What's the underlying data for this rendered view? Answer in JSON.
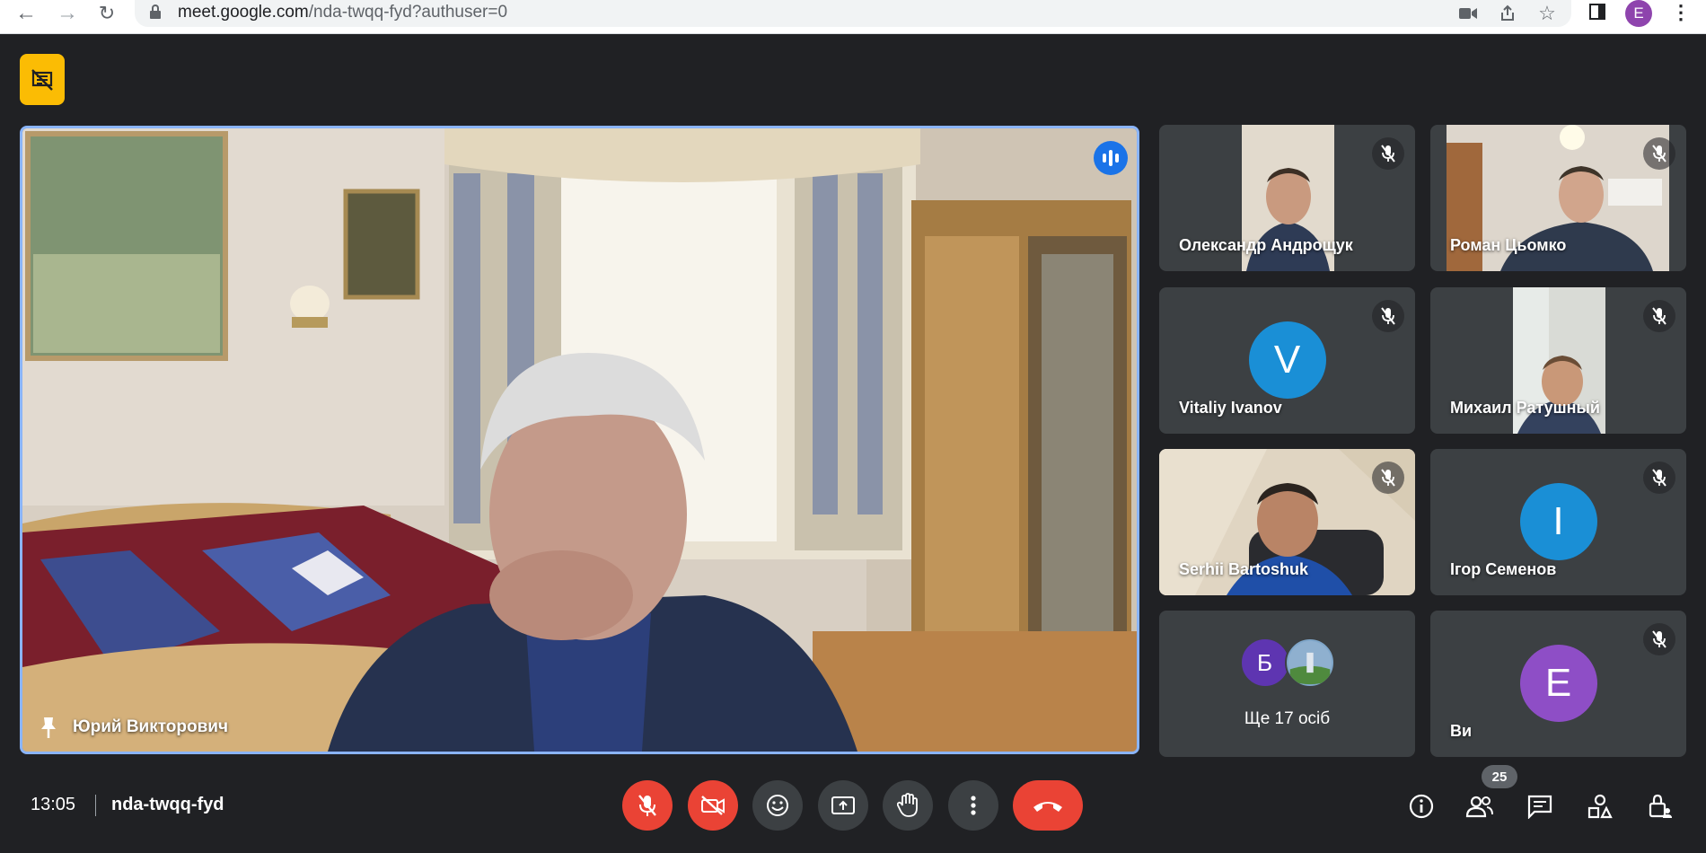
{
  "browser": {
    "url_host": "meet.google.com",
    "url_path": "/nda-twqq-fyd?authuser=0",
    "profile_initial": "E"
  },
  "main_tile": {
    "participant_name": "Юрий Викторович"
  },
  "participants": [
    {
      "name": "Олександр Андрощук",
      "muted": true,
      "video": true
    },
    {
      "name": "Роман Цьомко",
      "muted": true,
      "video": true
    },
    {
      "name": "Vitaliy Ivanov",
      "muted": true,
      "video": false,
      "initial": "V",
      "avatar_color": "#1a8fd6"
    },
    {
      "name": "Михаил Ратушный",
      "muted": true,
      "video": true
    },
    {
      "name": "Serhii Bartoshuk",
      "muted": true,
      "video": true
    },
    {
      "name": "Ігор Семенов",
      "muted": true,
      "video": false,
      "initial": "I",
      "avatar_color": "#1a8fd6"
    },
    {
      "name": "Ви",
      "muted": true,
      "video": false,
      "initial": "E",
      "avatar_color": "#8e4ec6"
    }
  ],
  "others_tile": {
    "initial": "Б",
    "label": "Ще 17 осіб"
  },
  "bottom_bar": {
    "time": "13:05",
    "meeting_code": "nda-twqq-fyd",
    "participant_count": "25"
  },
  "colors": {
    "background": "#202124",
    "tile": "#3c4043",
    "danger": "#ea4335",
    "active_speaker_border": "#8ab4f8",
    "badge_yellow": "#fbbc04"
  }
}
